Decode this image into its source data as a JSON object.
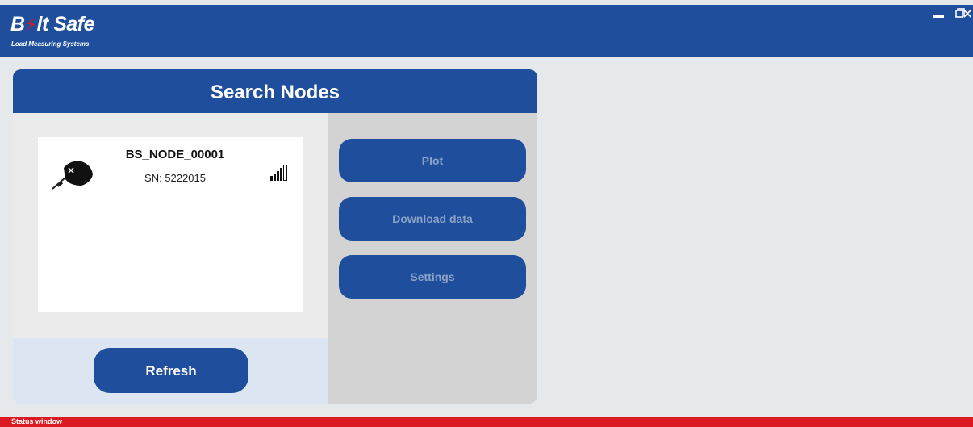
{
  "app": {
    "logo_text_1": "B",
    "logo_text_2": "lt Safe",
    "tagline": "Load Measuring Systems",
    "brand_color": "#1f4f9c",
    "accent_color": "#e0111e"
  },
  "window_controls": {
    "minimize": "minimize-icon",
    "restore": "restore-icon",
    "close": "✕"
  },
  "panel": {
    "title": "Search Nodes"
  },
  "nodes": [
    {
      "name": "BS_NODE_00001",
      "serial": "SN: 5222015",
      "icon": "sensor-device-icon",
      "signal_icon": "signal-strength-icon"
    }
  ],
  "buttons": {
    "refresh": "Refresh",
    "plot": "Plot",
    "download": "Download data",
    "settings": "Settings"
  },
  "statusbar": {
    "label": "Status window",
    "color": "#dc1a22"
  }
}
